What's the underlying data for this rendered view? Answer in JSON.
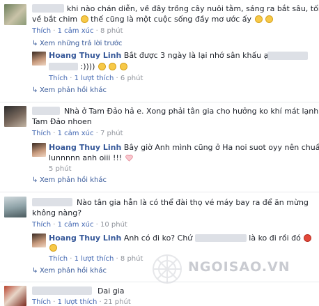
{
  "comments": [
    {
      "text_line1": "khi nào chán diễn, về đây trồng cây nuôi tằm, sáng ra bắt sâu, tối",
      "text_line2": "về bắt chim",
      "text_line2b": "thế cũng là một cuộc sống đầy mơ ước ấy",
      "action": "Thích",
      "reactions": "1 cảm xúc",
      "time": "8 phút",
      "view_prev": "Xem những trả lời trước",
      "reply": {
        "name": "Hoang Thuy Linh",
        "text_line1": "Bắt được 3 ngày là lại nhớ sân khấu ạ! Lại nhớ",
        "text_line2": ":))))",
        "action": "Thích",
        "reactions": "1 lượt thích",
        "time": "6 phút"
      },
      "more": "Xem phản hồi khác"
    },
    {
      "text_line1": "Nhà ở Tam Đảo hả e. Xong phải tân gia cho hưởng ko khí mát lạnh của",
      "text_line2": "Tam Đảo nhoen",
      "action": "Thích",
      "reactions": "1 cảm xúc",
      "time": "7 phút",
      "reply": {
        "name": "Hoang Thuy Linh",
        "text_line1": "Bây giờ Anh mình cũng ở Ha noi suot oyy nên chuẩn",
        "text_line2": "lunnnnn anh oiii !!!",
        "time": "5 phút"
      },
      "more": "Xem phản hồi khác"
    },
    {
      "text_line1": "Nào tân gia hẳn là có thể đài thọ vé máy bay ra để ăn mừng",
      "text_line2": "không nàng?",
      "action": "Thích",
      "reactions": "1 cảm xúc",
      "time": "10 phút",
      "reply": {
        "name": "Hoang Thuy Linh",
        "text_a": "Anh có đi ko? Chứ",
        "text_b": "là ko đi rồi đó",
        "action": "Thích",
        "reactions": "1 lượt thích",
        "time": "8 phút"
      },
      "more": "Xem phản hồi khác"
    },
    {
      "text_line1": "Dai gia",
      "action": "Thích",
      "reactions": "1 lượt thích",
      "time": "21 phút"
    }
  ],
  "watermark": "NGOISAO.VN",
  "colors": {
    "link": "#365899",
    "meta": "#90949c",
    "blur": "#dde0e6",
    "emoji": "#f7c948"
  }
}
